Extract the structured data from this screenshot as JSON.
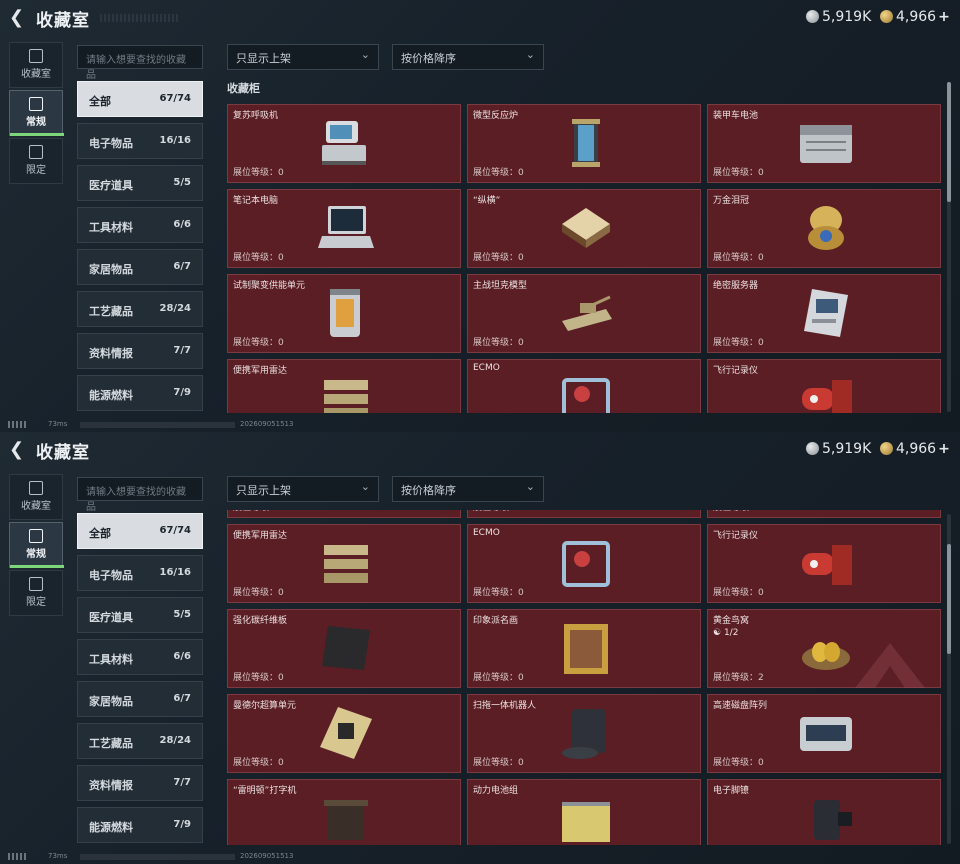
{
  "header": {
    "title": "收藏室",
    "silver": "5,919K",
    "gold": "4,966",
    "gold_plus": "+"
  },
  "left_tabs": [
    {
      "label": "收藏室",
      "icon": "archive-icon"
    },
    {
      "label": "常规",
      "icon": "picture-icon"
    },
    {
      "label": "限定",
      "icon": "limited-icon"
    }
  ],
  "search": {
    "placeholder": "请输入想要查找的收藏品"
  },
  "filter": {
    "value": "只显示上架"
  },
  "sort": {
    "value": "按价格降序"
  },
  "section_title": "收藏柜",
  "subnav": [
    {
      "label": "全部",
      "count": "67/74"
    },
    {
      "label": "电子物品",
      "count": "16/16"
    },
    {
      "label": "医疗道具",
      "count": "5/5"
    },
    {
      "label": "工具材料",
      "count": "6/6"
    },
    {
      "label": "家居物品",
      "count": "6/7"
    },
    {
      "label": "工艺藏品",
      "count": "28/24"
    },
    {
      "label": "资料情报",
      "count": "7/7"
    },
    {
      "label": "能源燃料",
      "count": "7/9"
    }
  ],
  "level_prefix": "展位等级：",
  "screen1_items": [
    {
      "name": "复苏呼吸机",
      "level": "0",
      "icon": "ventilator-icon"
    },
    {
      "name": "微型反应炉",
      "level": "0",
      "icon": "reactor-icon"
    },
    {
      "name": "装甲车电池",
      "level": "0",
      "icon": "battery-icon"
    },
    {
      "name": "笔记本电脑",
      "level": "0",
      "icon": "laptop-icon"
    },
    {
      "name": "“纵横”",
      "level": "0",
      "icon": "chessboard-icon"
    },
    {
      "name": "万金泪冠",
      "level": "0",
      "icon": "jewel-egg-icon"
    },
    {
      "name": "试制聚变供能单元",
      "level": "0",
      "icon": "fusion-cell-icon"
    },
    {
      "name": "主战坦克模型",
      "level": "0",
      "icon": "tank-icon"
    },
    {
      "name": "绝密服务器",
      "level": "0",
      "icon": "server-icon"
    },
    {
      "name": "便携军用雷达",
      "level": "",
      "icon": "radar-icon"
    },
    {
      "name": "ECMO",
      "level": "",
      "icon": "ecmo-icon"
    },
    {
      "name": "飞行记录仪",
      "level": "",
      "icon": "flight-recorder-icon"
    }
  ],
  "screen2_prev_levels": [
    "0",
    "0",
    "0"
  ],
  "screen2_items": [
    {
      "name": "便携军用雷达",
      "level": "0",
      "icon": "radar-icon"
    },
    {
      "name": "ECMO",
      "level": "0",
      "icon": "ecmo-icon"
    },
    {
      "name": "飞行记录仪",
      "level": "0",
      "icon": "flight-recorder-icon"
    },
    {
      "name": "强化碳纤维板",
      "level": "0",
      "icon": "carbon-plate-icon"
    },
    {
      "name": "印象派名画",
      "level": "0",
      "icon": "painting-icon"
    },
    {
      "name": "黄金鸟窝",
      "level": "2",
      "icon": "golden-nest-icon",
      "extra": "1/2"
    },
    {
      "name": "曼德尔超算单元",
      "level": "0",
      "icon": "supercomputer-icon"
    },
    {
      "name": "扫拖一体机器人",
      "level": "0",
      "icon": "robot-vacuum-icon"
    },
    {
      "name": "高速磁盘阵列",
      "level": "0",
      "icon": "disk-array-icon"
    },
    {
      "name": "“雷明顿”打字机",
      "level": "",
      "icon": "typewriter-icon"
    },
    {
      "name": "动力电池组",
      "level": "",
      "icon": "battery-pack-icon"
    },
    {
      "name": "电子脚镣",
      "level": "",
      "icon": "ankle-monitor-icon"
    }
  ],
  "status": {
    "ms": "73ms",
    "uid": "202609051513"
  },
  "colors": {
    "card_bg": "#5a1e24",
    "accent_green": "#7ed67a"
  }
}
